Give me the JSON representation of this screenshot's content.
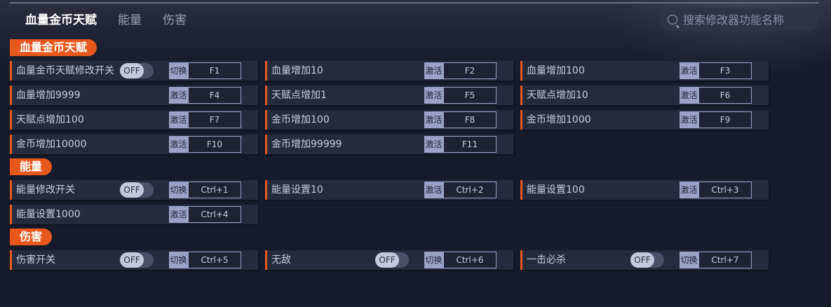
{
  "nav": {
    "tabs": [
      {
        "label": "血量金币天赋",
        "active": true
      },
      {
        "label": "能量",
        "active": false
      },
      {
        "label": "伤害",
        "active": false
      }
    ]
  },
  "search": {
    "placeholder": "搜索修改器功能名称"
  },
  "sections": [
    {
      "label": "血量金币天赋",
      "rows": [
        [
          {
            "name": "血量金币天赋修改开关",
            "toggle": "OFF",
            "action": "切换",
            "key": "F1"
          },
          {
            "name": "血量增加10",
            "action": "激活",
            "key": "F2"
          },
          {
            "name": "血量增加100",
            "action": "激活",
            "key": "F3"
          }
        ],
        [
          {
            "name": "血量增加9999",
            "action": "激活",
            "key": "F4"
          },
          {
            "name": "天赋点增加1",
            "action": "激活",
            "key": "F5"
          },
          {
            "name": "天赋点增加10",
            "action": "激活",
            "key": "F6"
          }
        ],
        [
          {
            "name": "天赋点增加100",
            "action": "激活",
            "key": "F7"
          },
          {
            "name": "金币增加100",
            "action": "激活",
            "key": "F8"
          },
          {
            "name": "金币增加1000",
            "action": "激活",
            "key": "F9"
          }
        ],
        [
          {
            "name": "金币增加10000",
            "action": "激活",
            "key": "F10"
          },
          {
            "name": "金币增加99999",
            "action": "激活",
            "key": "F11"
          }
        ]
      ]
    },
    {
      "label": "能量",
      "rows": [
        [
          {
            "name": "能量修改开关",
            "toggle": "OFF",
            "action": "切换",
            "key": "Ctrl+1"
          },
          {
            "name": "能量设置10",
            "action": "激活",
            "key": "Ctrl+2"
          },
          {
            "name": "能量设置100",
            "action": "激活",
            "key": "Ctrl+3"
          }
        ],
        [
          {
            "name": "能量设置1000",
            "action": "激活",
            "key": "Ctrl+4"
          }
        ]
      ]
    },
    {
      "label": "伤害",
      "rows": [
        [
          {
            "name": "伤害开关",
            "toggle": "OFF",
            "action": "切换",
            "key": "Ctrl+5"
          },
          {
            "name": "无敌",
            "toggle": "OFF",
            "action": "切换",
            "key": "Ctrl+6"
          },
          {
            "name": "一击必杀",
            "toggle": "OFF",
            "action": "切换",
            "key": "Ctrl+7"
          }
        ]
      ]
    }
  ]
}
